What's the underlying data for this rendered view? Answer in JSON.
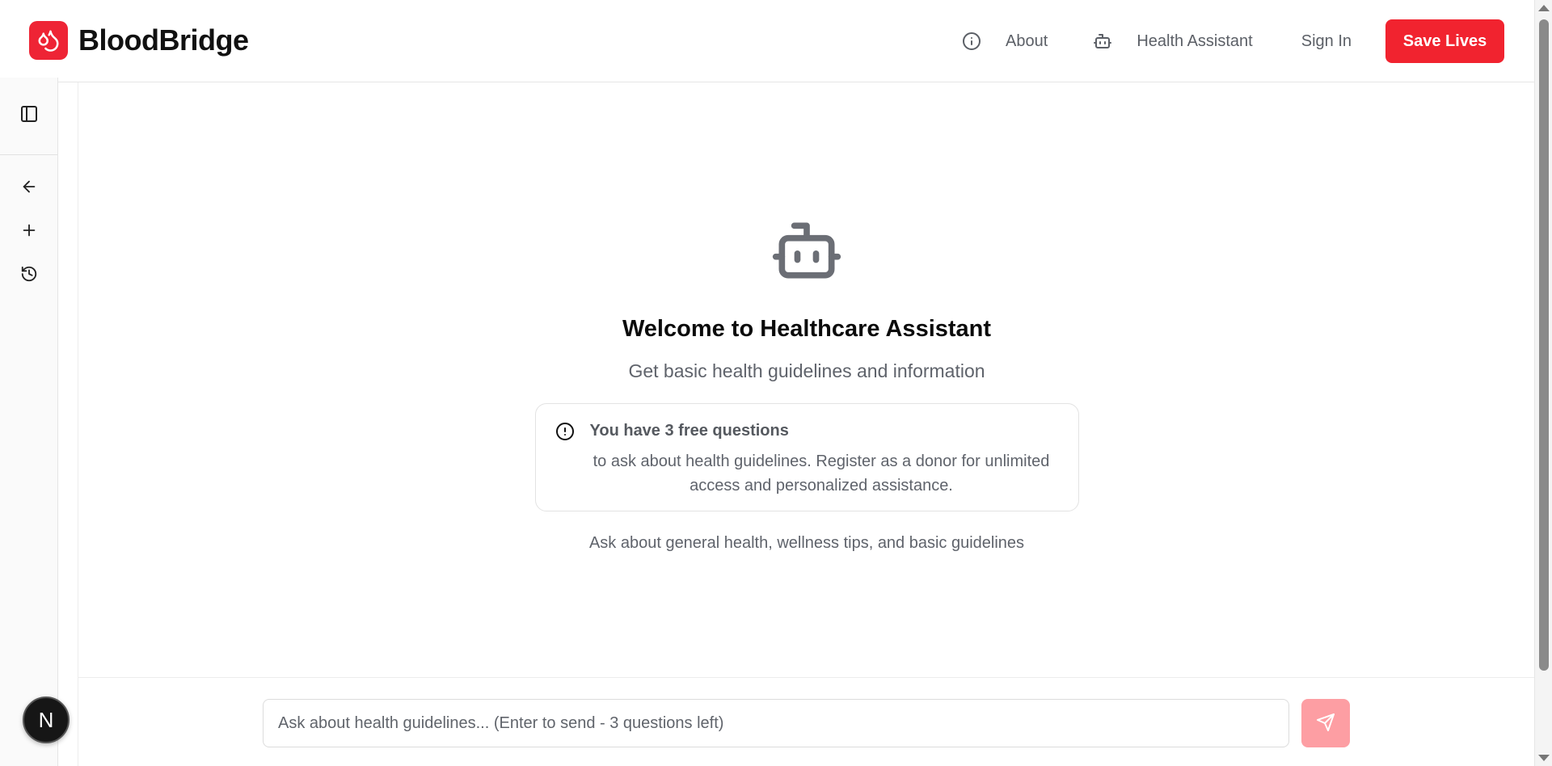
{
  "brand": {
    "name": "BloodBridge",
    "accent_color": "#f1232f"
  },
  "nav": {
    "about_label": "About",
    "assistant_label": "Health Assistant",
    "signin_label": "Sign In",
    "cta_label": "Save Lives"
  },
  "sidebar": {
    "items": [
      {
        "icon": "sidebar-toggle-icon"
      },
      {
        "icon": "arrow-left-icon"
      },
      {
        "icon": "plus-icon"
      },
      {
        "icon": "history-icon"
      }
    ]
  },
  "welcome": {
    "title": "Welcome to Healthcare Assistant",
    "subtitle": "Get basic health guidelines and information",
    "notice_title": "You have 3 free questions",
    "notice_body": "to ask about health guidelines. Register as a donor for unlimited access and personalized assistance.",
    "hint": "Ask about general health, wellness tips, and basic guidelines"
  },
  "chat": {
    "placeholder": "Ask about health guidelines... (Enter to send - 3 questions left)",
    "value": ""
  },
  "avatar": {
    "initial": "N"
  }
}
